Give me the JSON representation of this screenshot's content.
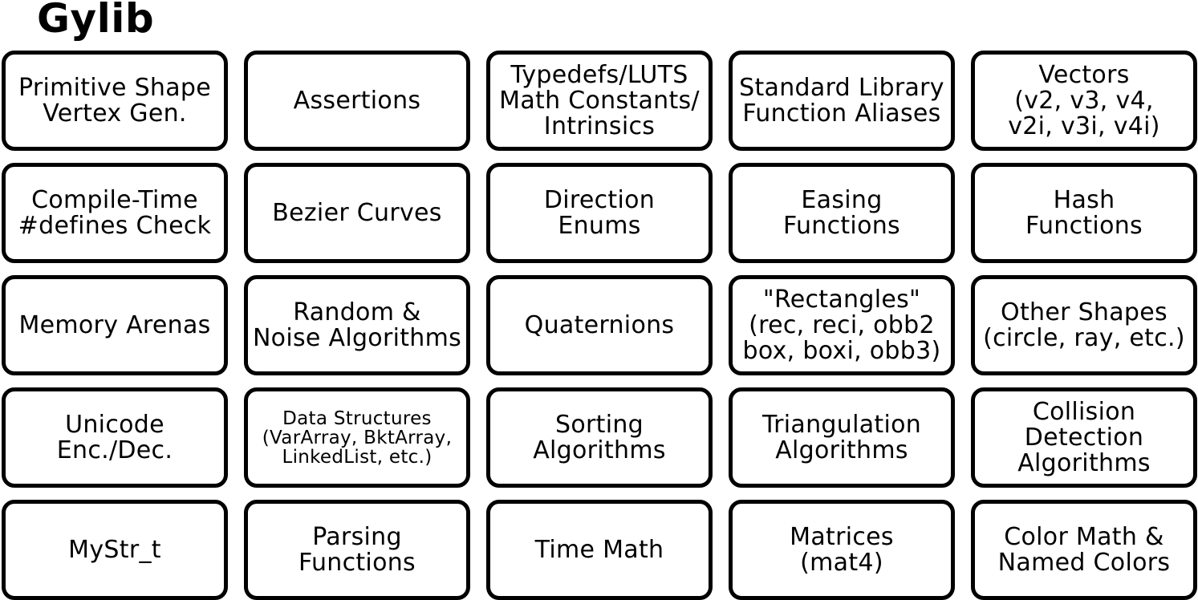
{
  "title": "Gylib",
  "modules": [
    [
      "Primitive Shape\nVertex Gen.",
      "Assertions",
      "Typedefs/LUTS\nMath Constants/\nIntrinsics",
      "Standard Library\nFunction Aliases",
      "Vectors\n(v2, v3, v4,\nv2i, v3i, v4i)"
    ],
    [
      "Compile-Time\n#defines Check",
      "Bezier Curves",
      "Direction\nEnums",
      "Easing\nFunctions",
      "Hash\nFunctions"
    ],
    [
      "Memory Arenas",
      "Random &\nNoise Algorithms",
      "Quaternions",
      "\"Rectangles\"\n(rec, reci, obb2\nbox, boxi, obb3)",
      "Other Shapes\n(circle, ray, etc.)"
    ],
    [
      "Unicode\nEnc./Dec.",
      "Data Structures\n(VarArray, BktArray,\nLinkedList, etc.)",
      "Sorting\nAlgorithms",
      "Triangulation\nAlgorithms",
      "Collision\nDetection\nAlgorithms"
    ],
    [
      "MyStr_t",
      "Parsing\nFunctions",
      "Time Math",
      "Matrices\n(mat4)",
      "Color Math &\nNamed Colors"
    ]
  ]
}
